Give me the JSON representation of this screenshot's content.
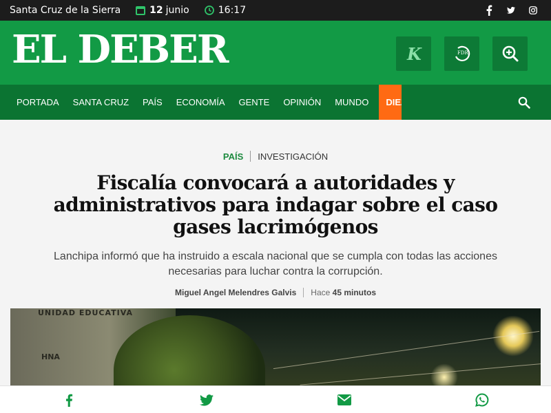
{
  "topbar": {
    "city": "Santa Cruz de la Sierra",
    "date_day": "12",
    "date_month": "junio",
    "time": "16:17",
    "icons": [
      "calendar-icon",
      "clock-icon",
      "facebook-icon",
      "twitter-icon",
      "instagram-icon"
    ]
  },
  "header": {
    "logo": "EL DEBER",
    "buttons": [
      "k-magazine-icon",
      "fdr-radio-icon",
      "zoom-icon"
    ],
    "fdr_label": "FDR"
  },
  "nav": {
    "items": [
      "PORTADA",
      "SANTA CRUZ",
      "PAÍS",
      "ECONOMÍA",
      "GENTE",
      "OPINIÓN",
      "MUNDO",
      "DIEZ"
    ]
  },
  "article": {
    "section": "PAÍS",
    "subsection": "INVESTIGACIÓN",
    "headline": "Fiscalía convocará a autoridades y administrativos para indagar sobre el caso gases lacrimógenos",
    "subtitle": "Lanchipa informó que ha instruido a escala nacional que se cumpla con todas las acciones necesarias para luchar contra la corrupción.",
    "author": "Miguel Angel Melendres Galvis",
    "ago_prefix": "Hace",
    "ago_value": "45 minutos",
    "photo_sign_top": "UNIDAD EDUCATIVA",
    "photo_sign_mid": "HNA"
  },
  "share": {
    "icons": [
      "facebook-icon",
      "twitter-icon",
      "email-icon",
      "whatsapp-icon"
    ]
  },
  "colors": {
    "brand_green": "#129a45",
    "nav_green": "#0b7432",
    "accent_orange": "#ff6a13",
    "topbar": "#1c1c1c"
  }
}
